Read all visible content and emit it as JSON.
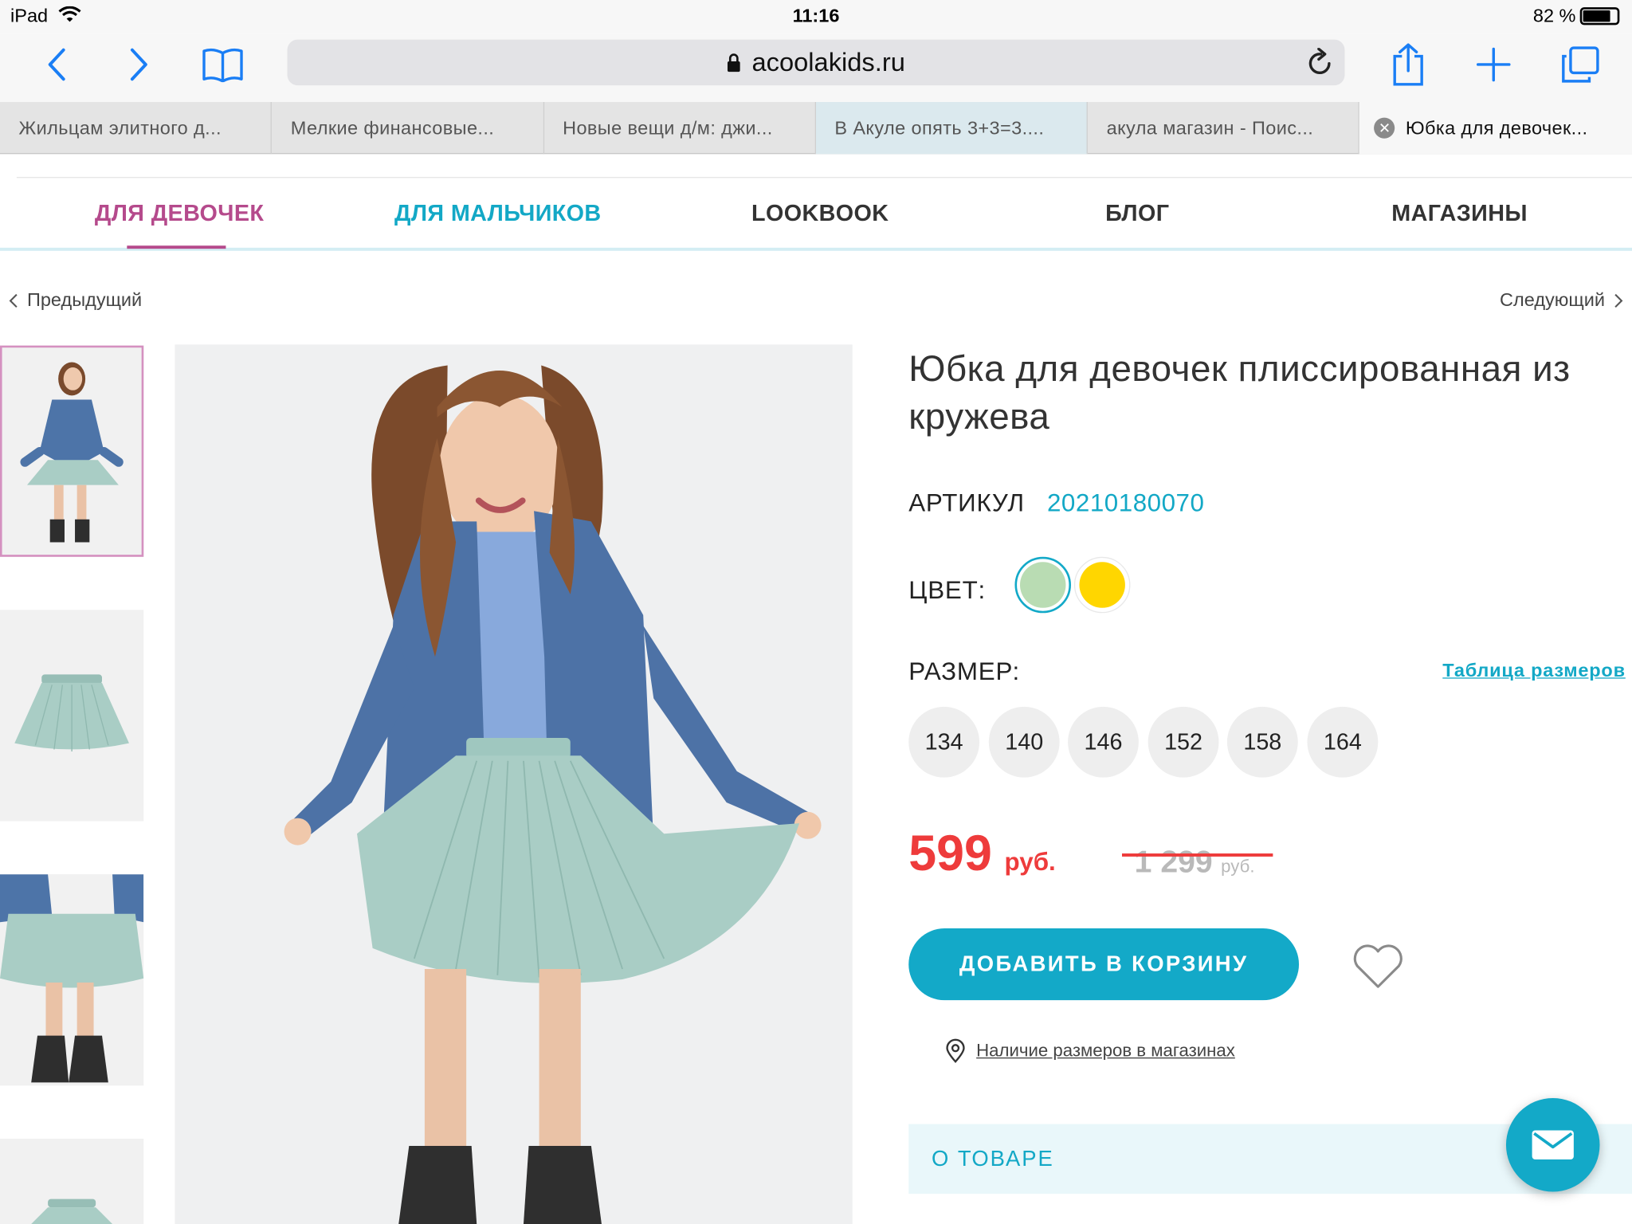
{
  "status_bar": {
    "device": "iPad",
    "time": "11:16",
    "battery": "82 %",
    "battery_level": 0.82
  },
  "browser": {
    "url": "acoolakids.ru",
    "tabs": [
      {
        "label": "Жильцам элитного д..."
      },
      {
        "label": "Мелкие финансовые..."
      },
      {
        "label": "Новые вещи д/м: джи..."
      },
      {
        "label": "В Акуле опять 3+3=3...."
      },
      {
        "label": "акула магазин - Поис..."
      },
      {
        "label": "Юбка для девочек..."
      }
    ]
  },
  "nav": {
    "items": [
      {
        "label": "ДЛЯ ДЕВОЧЕК",
        "color": "#b54a8c"
      },
      {
        "label": "ДЛЯ МАЛЬЧИКОВ",
        "color": "#13a8c6"
      },
      {
        "label": "LOOKBOOK",
        "color": "#333333"
      },
      {
        "label": "БЛОГ",
        "color": "#333333"
      },
      {
        "label": "МАГАЗИНЫ",
        "color": "#333333"
      }
    ]
  },
  "pager": {
    "prev": "Предыдущий",
    "next": "Следующий"
  },
  "product": {
    "title": "Юбка для девочек плиссированная из кружева",
    "article_label": "АРТИКУЛ",
    "article": "20210180070",
    "color_label": "ЦВЕТ:",
    "colors": [
      "#b9dcb3",
      "#ffd600"
    ],
    "size_label": "РАЗМЕР:",
    "size_table": "Таблица размеров",
    "sizes": [
      "134",
      "140",
      "146",
      "152",
      "158",
      "164"
    ],
    "price": "599",
    "currency": "руб.",
    "old_price": "1 299",
    "old_currency": "руб.",
    "add_to_cart": "ДОБАВИТЬ В КОРЗИНУ",
    "availability": "Наличие размеров в магазинах",
    "about": "О ТОВАРЕ"
  },
  "colors": {
    "accent": "#13a9c8",
    "brand_pink": "#b54a8c",
    "price_red": "#ee3b3b"
  },
  "icons": [
    "back-icon",
    "forward-icon",
    "bookmarks-icon",
    "lock-icon",
    "reload-icon",
    "share-icon",
    "new-tab-icon",
    "tabs-icon",
    "close-tab-icon",
    "heart-icon",
    "location-pin-icon",
    "mail-icon"
  ]
}
